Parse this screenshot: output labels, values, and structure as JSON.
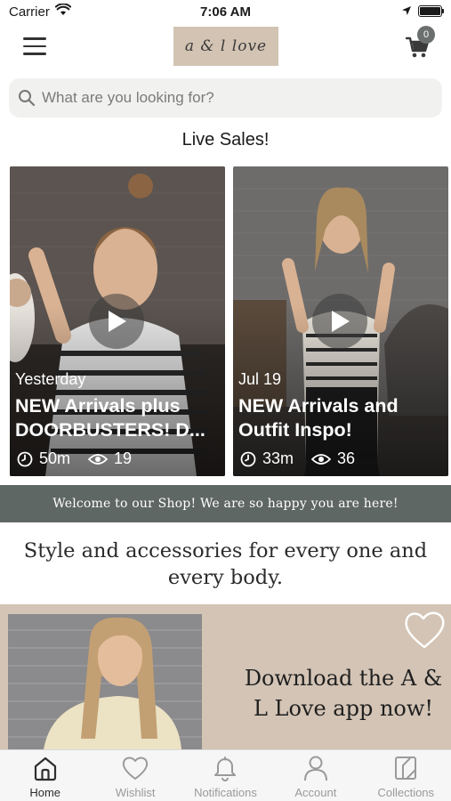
{
  "status_bar": {
    "carrier": "Carrier",
    "time": "7:06 AM"
  },
  "header": {
    "logo_text": "a & l love",
    "cart_count": "0"
  },
  "search": {
    "placeholder": "What are you looking for?"
  },
  "live_sales": {
    "title": "Live Sales!",
    "videos": [
      {
        "date": "Yesterday",
        "title": "NEW Arrivals plus DOORBUSTERS! D...",
        "duration": "50m",
        "views": "19"
      },
      {
        "date": "Jul 19",
        "title": "NEW Arrivals and Outfit Inspo!",
        "duration": "33m",
        "views": "36"
      }
    ]
  },
  "welcome_banner": "Welcome to our Shop! We are so happy you are here!",
  "tagline": "Style and accessories for every one and every body.",
  "promo": {
    "text": "Download the A & L Love app now!"
  },
  "tabbar": {
    "items": [
      {
        "label": "Home",
        "icon": "home-icon",
        "active": true
      },
      {
        "label": "Wishlist",
        "icon": "heart-icon",
        "active": false
      },
      {
        "label": "Notifications",
        "icon": "bell-icon",
        "active": false
      },
      {
        "label": "Account",
        "icon": "person-icon",
        "active": false
      },
      {
        "label": "Collections",
        "icon": "collections-icon",
        "active": false
      }
    ]
  },
  "colors": {
    "logo_bg": "#d2c3b3",
    "banner_bg": "#5f6765",
    "promo_bg": "#d3c4b5",
    "badge_bg": "#6b6f6d"
  }
}
